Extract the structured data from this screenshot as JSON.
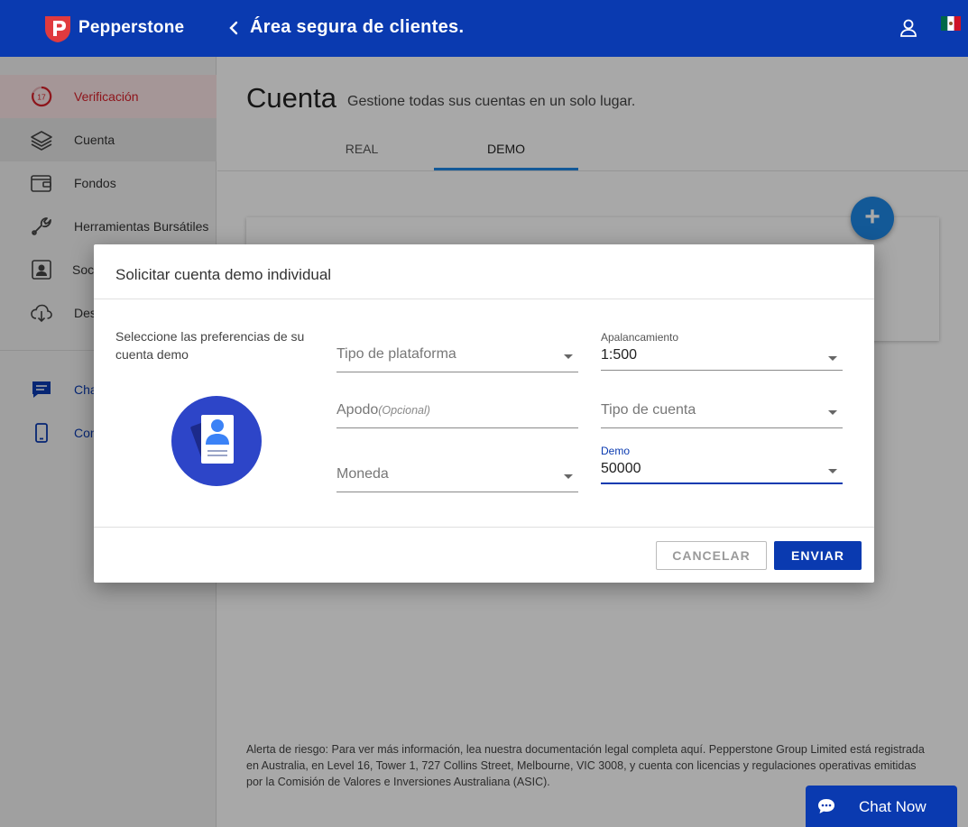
{
  "header": {
    "brand": "Pepperstone",
    "title": "Área segura de clientes."
  },
  "sidebar": {
    "items": [
      {
        "label": "Verificación",
        "badge": "17",
        "icon": "verification-progress-icon"
      },
      {
        "label": "Cuenta",
        "icon": "layers-icon"
      },
      {
        "label": "Fondos",
        "icon": "wallet-icon"
      },
      {
        "label": "Herramientas Bursátiles",
        "icon": "wrench-icon"
      },
      {
        "label": "Soci",
        "icon": "contacts-icon"
      },
      {
        "label": "Des",
        "icon": "cloud-download-icon"
      },
      {
        "label": "Cha",
        "icon": "chat-icon"
      },
      {
        "label": "Con",
        "icon": "phone-icon"
      }
    ]
  },
  "main": {
    "title": "Cuenta",
    "subtitle": "Gestione todas sus cuentas en un solo lugar.",
    "tabs": [
      {
        "label": "REAL",
        "active": false
      },
      {
        "label": "DEMO",
        "active": true
      }
    ],
    "fab_label": "+",
    "risk_text": "Alerta de riesgo: Para ver más información, lea nuestra documentación legal completa aquí. Pepperstone Group Limited está registrada en Australia, en Level 16, Tower 1, 727 Collins Street, Melbourne, VIC 3008, y cuenta con licencias y regulaciones operativas emitidas por la Comisión de Valores e Inversiones Australiana (ASIC)."
  },
  "modal": {
    "title": "Solicitar cuenta demo individual",
    "description": "Seleccione las preferencias de su cuenta demo",
    "fields": {
      "platform": {
        "placeholder": "Tipo de plataforma"
      },
      "leverage": {
        "label": "Apalancamiento",
        "value": "1:500"
      },
      "nickname": {
        "placeholder": "Apodo",
        "optional": "(Opcional)"
      },
      "account_type": {
        "placeholder": "Tipo de cuenta"
      },
      "currency": {
        "placeholder": "Moneda"
      },
      "demo": {
        "label": "Demo",
        "value": "50000"
      }
    },
    "cancel_label": "CANCELAR",
    "submit_label": "ENVIAR"
  },
  "chat": {
    "label": "Chat Now"
  },
  "colors": {
    "brand_blue": "#0a3ab0",
    "accent_blue": "#1e88e5",
    "alert_red": "#d8202a"
  }
}
